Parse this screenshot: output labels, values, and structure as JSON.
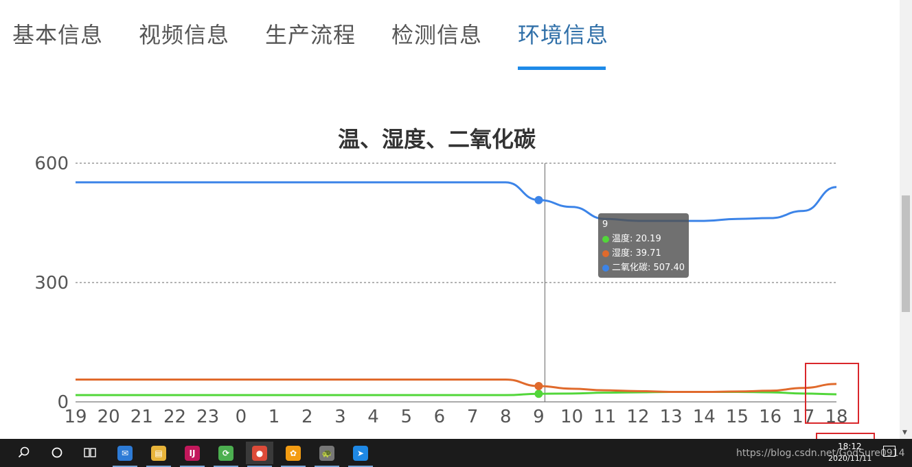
{
  "tabs": [
    {
      "label": "基本信息",
      "active": false
    },
    {
      "label": "视频信息",
      "active": false
    },
    {
      "label": "生产流程",
      "active": false
    },
    {
      "label": "检测信息",
      "active": false
    },
    {
      "label": "环境信息",
      "active": true
    }
  ],
  "colors": {
    "accent": "#1e8ae8",
    "temperature": "#52d63a",
    "humidity": "#e06a2c",
    "co2": "#3c84e8",
    "highlight": "#d9262a"
  },
  "chart_data": {
    "type": "line",
    "title": "温、湿度、二氧化碳",
    "categories": [
      "19",
      "20",
      "21",
      "22",
      "23",
      "0",
      "1",
      "2",
      "3",
      "4",
      "5",
      "6",
      "7",
      "8",
      "9",
      "10",
      "11",
      "12",
      "13",
      "14",
      "15",
      "16",
      "17",
      "18"
    ],
    "y_ticks": [
      "600",
      "300",
      "0"
    ],
    "ylim": [
      0,
      600
    ],
    "grid": true,
    "series": [
      {
        "name": "温度",
        "color": "#52d63a",
        "values": [
          17,
          17,
          17,
          17,
          17,
          17,
          17,
          17,
          17,
          17,
          17,
          17,
          17,
          17,
          20.19,
          21,
          23,
          24,
          25,
          25,
          25,
          24,
          21,
          19
        ]
      },
      {
        "name": "湿度",
        "color": "#e06a2c",
        "values": [
          56,
          56,
          56,
          56,
          56,
          56,
          56,
          56,
          56,
          56,
          56,
          56,
          56,
          56,
          39.71,
          33,
          29,
          27,
          25,
          25,
          26,
          28,
          35,
          45
        ]
      },
      {
        "name": "二氧化碳",
        "color": "#3c84e8",
        "values": [
          552,
          552,
          552,
          552,
          552,
          552,
          552,
          552,
          552,
          552,
          552,
          552,
          552,
          552,
          507.4,
          490,
          460,
          455,
          455,
          455,
          460,
          462,
          480,
          540
        ]
      }
    ],
    "tooltip": {
      "header": "9",
      "rows": [
        {
          "label": "温度: 20.19",
          "color": "#52d63a"
        },
        {
          "label": "湿度: 39.71",
          "color": "#e06a2c"
        },
        {
          "label": "二氧化碳: 507.40",
          "color": "#3c84e8"
        }
      ],
      "category_index": 14
    }
  },
  "taskbar": {
    "search_icon": "search-icon",
    "cortana_icon": "circle-icon",
    "taskview_icon": "task-view-icon",
    "apps": [
      {
        "name": "mail-app-icon",
        "glyph": "✉",
        "color": "#2d7bd6",
        "active": false
      },
      {
        "name": "file-explorer-icon",
        "glyph": "▤",
        "color": "#e8b43a",
        "active": false
      },
      {
        "name": "intellij-icon",
        "glyph": "IJ",
        "color": "#c2185b",
        "active": false
      },
      {
        "name": "refresh-app-icon",
        "glyph": "⟳",
        "color": "#4caf50",
        "active": false
      },
      {
        "name": "chrome-icon",
        "glyph": "●",
        "color": "#dd4b39",
        "active": true
      },
      {
        "name": "photos-app-icon",
        "glyph": "✿",
        "color": "#f39c12",
        "active": false
      },
      {
        "name": "turtle-app-icon",
        "glyph": "🐢",
        "color": "#777777",
        "active": false
      },
      {
        "name": "feishu-app-icon",
        "glyph": "➤",
        "color": "#1e88e5",
        "active": false
      }
    ],
    "url_overlay": "https://blog.csdn.net/GodSure0914",
    "time": "18:12",
    "date": "2020/11/11"
  }
}
